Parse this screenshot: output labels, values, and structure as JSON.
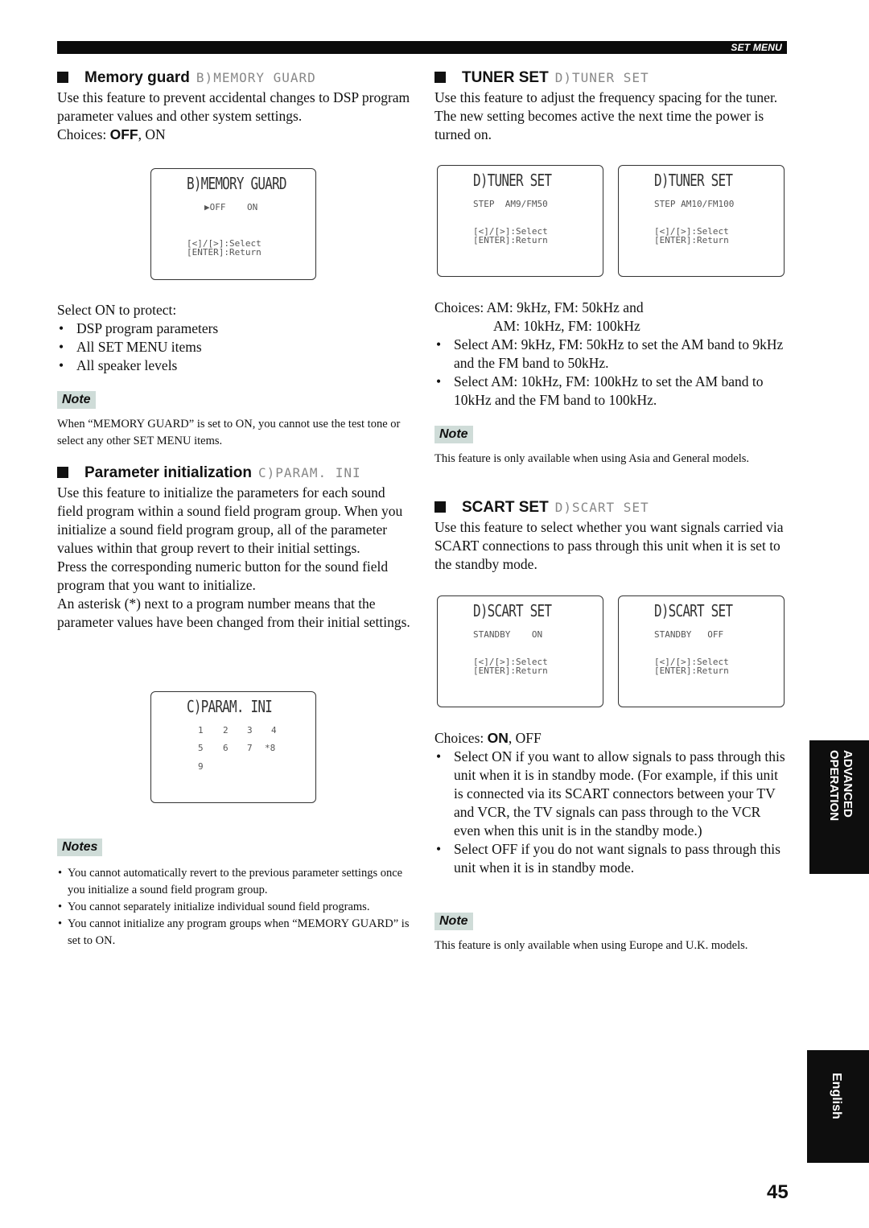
{
  "header": {
    "section_label": "SET MENU"
  },
  "memory_guard": {
    "title": "Memory guard",
    "lcd_label": "B)MEMORY GUARD",
    "description": "Use this feature to prevent accidental changes to DSP program parameter values and other system settings.",
    "choices_prefix": "Choices: ",
    "choice_default": "OFF",
    "choices_rest": ", ON",
    "screen": {
      "title": "B)MEMORY GUARD",
      "cursor": "▶",
      "option_off": "OFF",
      "option_on": "ON",
      "help_select": "[<]/[>]:Select",
      "help_return": "[ENTER]:Return"
    },
    "protect_intro": "Select ON to protect:",
    "protect_items": [
      "DSP program parameters",
      "All SET MENU items",
      "All speaker levels"
    ],
    "note_label": "Note",
    "note_text": "When “MEMORY GUARD” is set to ON, you cannot use the test tone or select any other SET MENU items."
  },
  "param_init": {
    "title": "Parameter initialization",
    "lcd_label": "C)PARAM. INI",
    "paragraphs": [
      "Use this feature to initialize the parameters for each sound field program within a sound field program group. When you initialize a sound field program group, all of the parameter values within that group revert to their initial settings.",
      "Press the corresponding numeric button for the sound field program that you want to initialize.",
      "An asterisk (*) next to a program number means that the parameter values have been changed from their initial settings."
    ],
    "screen": {
      "title": "C)PARAM. INI",
      "programs": [
        "1",
        "2",
        "3",
        "4",
        "5",
        "6",
        "7",
        "*8",
        "9"
      ]
    },
    "notes_label": "Notes",
    "notes": [
      "You cannot automatically revert to the previous parameter settings once you initialize a sound field program group.",
      "You cannot separately initialize individual sound field programs.",
      "You cannot initialize any program groups when “MEMORY GUARD” is set to ON."
    ]
  },
  "tuner_set": {
    "title": "TUNER SET",
    "lcd_label": "D)TUNER SET",
    "description": "Use this feature to adjust the frequency spacing for the tuner. The new setting becomes active the next time the power is turned on.",
    "screens": [
      {
        "title": "D)TUNER SET",
        "line": "STEP  AM9/FM50",
        "help_select": "[<]/[>]:Select",
        "help_return": "[ENTER]:Return"
      },
      {
        "title": "D)TUNER SET",
        "line": "STEP AM10/FM100",
        "help_select": "[<]/[>]:Select",
        "help_return": "[ENTER]:Return"
      }
    ],
    "choices_line1": "Choices: AM: 9kHz, FM: 50kHz and",
    "choices_line2": "AM: 10kHz, FM: 100kHz",
    "bullets": [
      "Select AM: 9kHz, FM: 50kHz to set the AM band to 9kHz and the FM band to 50kHz.",
      "Select AM: 10kHz, FM: 100kHz to set the AM band to 10kHz and the FM band to 100kHz."
    ],
    "note_label": "Note",
    "note_text": "This feature is only available when using Asia and General models."
  },
  "scart_set": {
    "title": "SCART SET",
    "lcd_label": "D)SCART SET",
    "description": "Use this feature to select whether you want signals carried via SCART connections to pass through this unit when it is set to the standby mode.",
    "screens": [
      {
        "title": "D)SCART SET",
        "line": "STANDBY    ON",
        "help_select": "[<]/[>]:Select",
        "help_return": "[ENTER]:Return"
      },
      {
        "title": "D)SCART SET",
        "line": "STANDBY   OFF",
        "help_select": "[<]/[>]:Select",
        "help_return": "[ENTER]:Return"
      }
    ],
    "choices_prefix": "Choices: ",
    "choice_default": "ON",
    "choices_rest": ", OFF",
    "bullets": [
      "Select ON if you want to allow signals to pass through this unit when it is in standby mode. (For example, if this unit is connected via its SCART connectors between your TV and VCR, the TV signals can pass through to the VCR even when this unit is in the standby mode.)",
      "Select OFF if you do not want signals to pass through this unit when it is in standby mode."
    ],
    "note_label": "Note",
    "note_text": "This feature is only available when using Europe and U.K. models."
  },
  "side_tabs": {
    "advanced_line1": "ADVANCED",
    "advanced_line2": "OPERATION",
    "language": "English"
  },
  "page_number": "45"
}
